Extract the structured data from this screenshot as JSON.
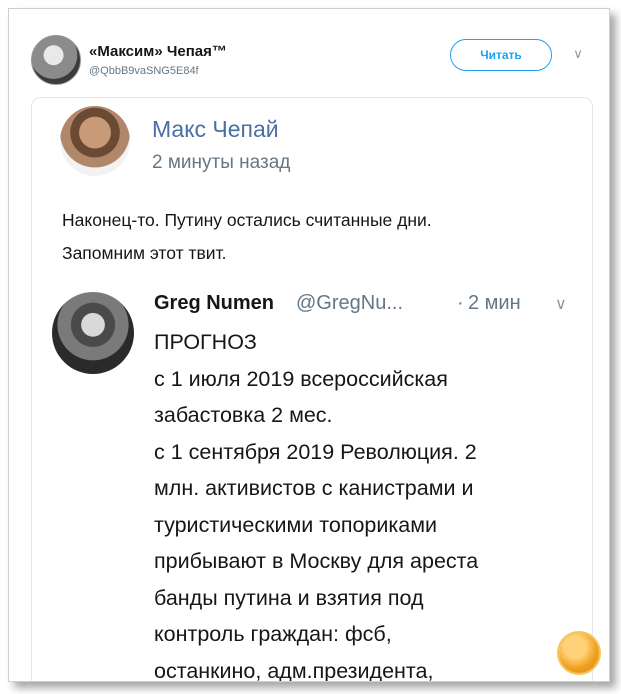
{
  "header": {
    "name": "«Максим» Чепая™",
    "handle": "@QbbB9vaSNG5E84f",
    "follow_label": "Читать",
    "chevron_icon": "chevron-down-icon"
  },
  "post": {
    "author": "Макс Чепай",
    "time": "2 минуты назад",
    "text_lines": [
      "Наконец-то. Путину остались считанные дни.",
      "Запомним этот твит."
    ]
  },
  "quoted": {
    "name": "Greg Numen",
    "handle": "@GregNu...",
    "separator": "·",
    "time": "2 мин",
    "chevron_icon": "chevron-down-icon",
    "lines": [
      "ПРОГНОЗ",
      "с 1 июля 2019 всероссийская",
      "забастовка 2 мес.",
      "с 1 сентября 2019 Революция. 2",
      "млн. активистов с канистрами и",
      "туристическими топориками",
      "прибывают в Москву для ареста",
      "банды путина и взятия под",
      "контроль граждан: фсб,",
      "останкино, адм.президента,"
    ]
  },
  "colors": {
    "accent": "#1da1f2",
    "author_link": "#4a6fa5",
    "muted": "#657786"
  }
}
